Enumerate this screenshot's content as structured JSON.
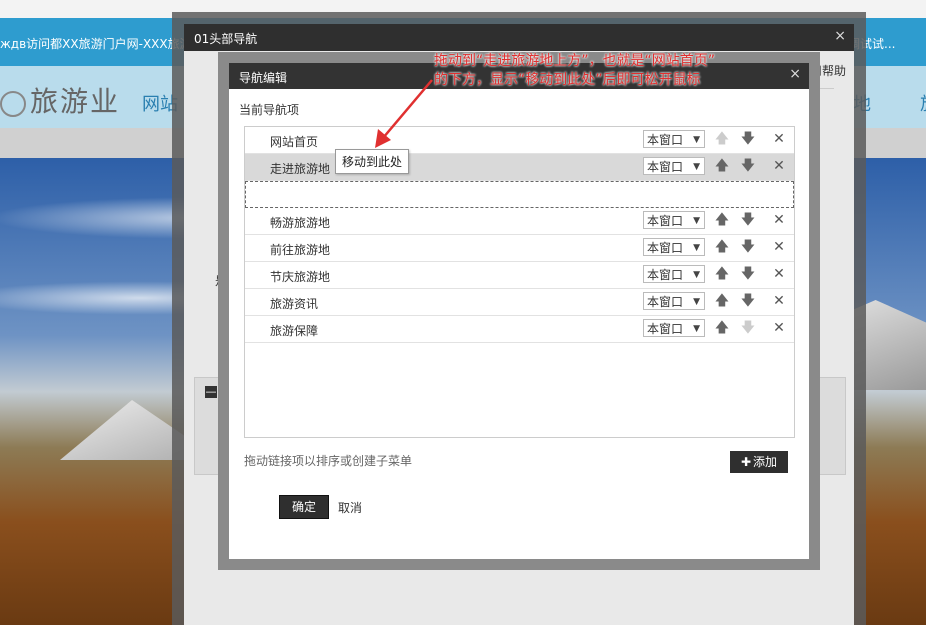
{
  "background": {
    "browser_title": "ждв访问都XX旅游门户网-XXX旅游门",
    "right_text": "调试试...",
    "logo_text": "旅游业",
    "nav_left": "网站",
    "nav_right": "地",
    "nav_edge": "旅"
  },
  "outer_dialog": {
    "title": "01头部导航",
    "close": "×",
    "help_text": "用帮助",
    "partial_label": "是",
    "panel_marker": "—"
  },
  "nav_editor": {
    "title": "导航编辑",
    "close": "×",
    "section_title": "当前导航项",
    "window_option": "本窗口",
    "caret": "▼",
    "up_symbol": "🡅",
    "down_symbol": "🡇",
    "delete_symbol": "✕",
    "items": [
      {
        "name": "网站首页"
      },
      {
        "name": "走进旅游地"
      },
      {
        "name": "畅游旅游地"
      },
      {
        "name": "前往旅游地"
      },
      {
        "name": "节庆旅游地"
      },
      {
        "name": "旅游资讯"
      },
      {
        "name": "旅游保障"
      }
    ],
    "drag_tooltip": "移动到此处",
    "hint": "拖动链接项以排序或创建子菜单",
    "add_label": "添加",
    "add_plus": "✚",
    "ok_label": "确定",
    "cancel_label": "取消"
  },
  "annotation": {
    "line1": "拖动到“走进旅游地上方”，也就是“网站首页”",
    "line2": "的下方，显示“移动到此处”后即可松开鼠标",
    "color": "#e03030"
  }
}
